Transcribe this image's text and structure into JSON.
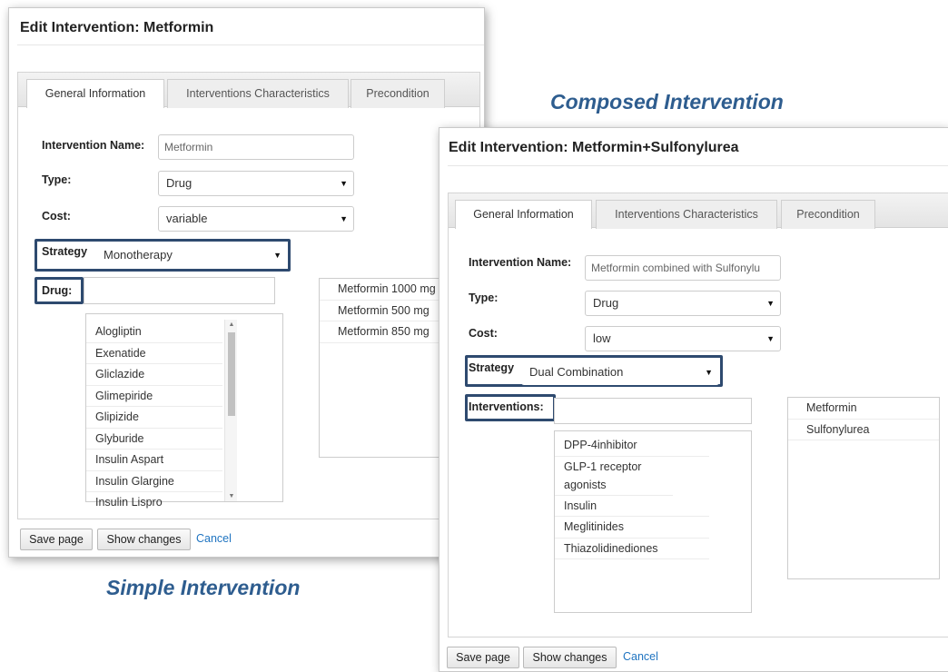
{
  "captions": {
    "composed": "Composed Intervention",
    "simple": "Simple Intervention"
  },
  "simple_window": {
    "title": "Edit Intervention: Metformin",
    "tabs": [
      "General Information",
      "Interventions Characteristics",
      "Precondition"
    ],
    "name_label": "Intervention Name:",
    "name_value": "Metformin",
    "type_label": "Type:",
    "type_value": "Drug",
    "cost_label": "Cost:",
    "cost_value": "variable",
    "strategy_label": "Strategy",
    "strategy_value": "Monotherapy",
    "drug_label": "Drug:",
    "drug_options": [
      "Alogliptin",
      "Exenatide",
      "Gliclazide",
      "Glimepiride",
      "Glipizide",
      "Glyburide",
      "Insulin Aspart",
      "Insulin Glargine",
      "Insulin Lispro"
    ],
    "selected_items": [
      "Metformin 1000 mg",
      "Metformin 500 mg",
      "Metformin 850 mg"
    ],
    "buttons": {
      "save": "Save page",
      "changes": "Show changes",
      "cancel": "Cancel"
    }
  },
  "composed_window": {
    "title": "Edit Intervention: Metformin+Sulfonylurea",
    "tabs": [
      "General Information",
      "Interventions Characteristics",
      "Precondition"
    ],
    "name_label": "Intervention Name:",
    "name_value": "Metformin combined with Sulfonylu",
    "type_label": "Type:",
    "type_value": "Drug",
    "cost_label": "Cost:",
    "cost_value": "low",
    "strategy_label": "Strategy",
    "strategy_value": "Dual Combination",
    "interventions_label": "Interventions:",
    "intervention_options": [
      "DPP-4inhibitor",
      "GLP-1 receptor agonists",
      "Insulin",
      "Meglitinides",
      "Thiazolidinediones"
    ],
    "selected_items": [
      "Metformin",
      "Sulfonylurea"
    ],
    "buttons": {
      "save": "Save page",
      "changes": "Show changes",
      "cancel": "Cancel"
    }
  },
  "colors": {
    "highlight": "#2e4a6f",
    "caption": "#2e5d8f",
    "link": "#1f74c1"
  },
  "icons": {
    "dropdown": "triangle-down-icon",
    "scroll_up": "scroll-up-arrow-icon",
    "scroll_down": "scroll-down-arrow-icon"
  }
}
